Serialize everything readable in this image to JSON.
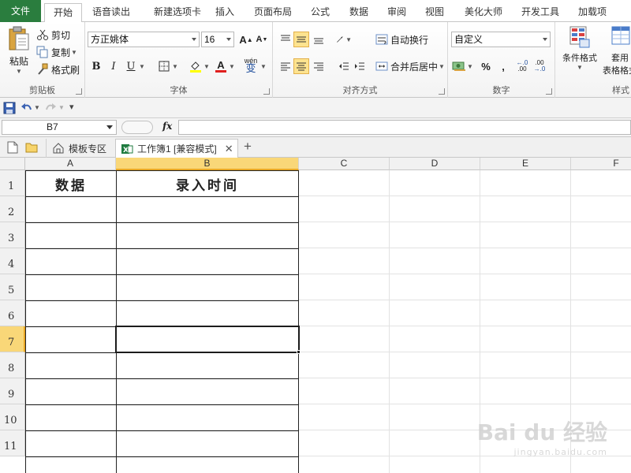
{
  "tabs": [
    {
      "label": "文件",
      "kind": "file"
    },
    {
      "label": "开始",
      "kind": "active"
    },
    {
      "label": "语音读出"
    },
    {
      "label": "新建选项卡"
    },
    {
      "label": "插入"
    },
    {
      "label": "页面布局"
    },
    {
      "label": "公式"
    },
    {
      "label": "数据"
    },
    {
      "label": "审阅"
    },
    {
      "label": "视图"
    },
    {
      "label": "美化大师"
    },
    {
      "label": "开发工具"
    },
    {
      "label": "加载项"
    }
  ],
  "clipboard": {
    "group_label": "剪贴板",
    "paste": "粘贴",
    "cut": "剪切",
    "copy": "复制",
    "format_painter": "格式刷"
  },
  "font": {
    "group_label": "字体",
    "family": "方正姚体",
    "size": "16",
    "bold": "B",
    "italic": "I",
    "underline": "U",
    "grow": "A",
    "shrink": "A",
    "color_a": "A",
    "wen": "wén",
    "wen_char": "变"
  },
  "alignment": {
    "group_label": "对齐方式",
    "wrap": "自动换行",
    "merge": "合并后居中"
  },
  "number": {
    "group_label": "数字",
    "format": "自定义",
    "percent": "%",
    "comma": ",",
    "inc": ".00",
    "dec": ".0"
  },
  "styles": {
    "group_label": "样式",
    "conditional": "条件格式",
    "table_format_1": "套用",
    "table_format_2": "表格格式"
  },
  "formula_bar": {
    "name_box": "B7",
    "fx": "fx",
    "value": ""
  },
  "doc_tabs": {
    "templates": "模板专区",
    "workbook": "工作簿1 [兼容模式]"
  },
  "grid": {
    "columns": [
      "A",
      "B",
      "C",
      "D",
      "E",
      "F"
    ],
    "selected_column": "B",
    "rows": [
      "1",
      "2",
      "3",
      "4",
      "5",
      "6",
      "7",
      "8",
      "9",
      "10",
      "11"
    ],
    "selected_row": "7",
    "headers": {
      "a1": "数据",
      "b1": "录入时间"
    }
  },
  "watermark": {
    "brand": "Bai du 经验",
    "url": "jingyan.baidu.com"
  },
  "colors": {
    "file_tab": "#2a7d3e",
    "selection_header": "#f9d778",
    "active_button": "#fde38f"
  }
}
